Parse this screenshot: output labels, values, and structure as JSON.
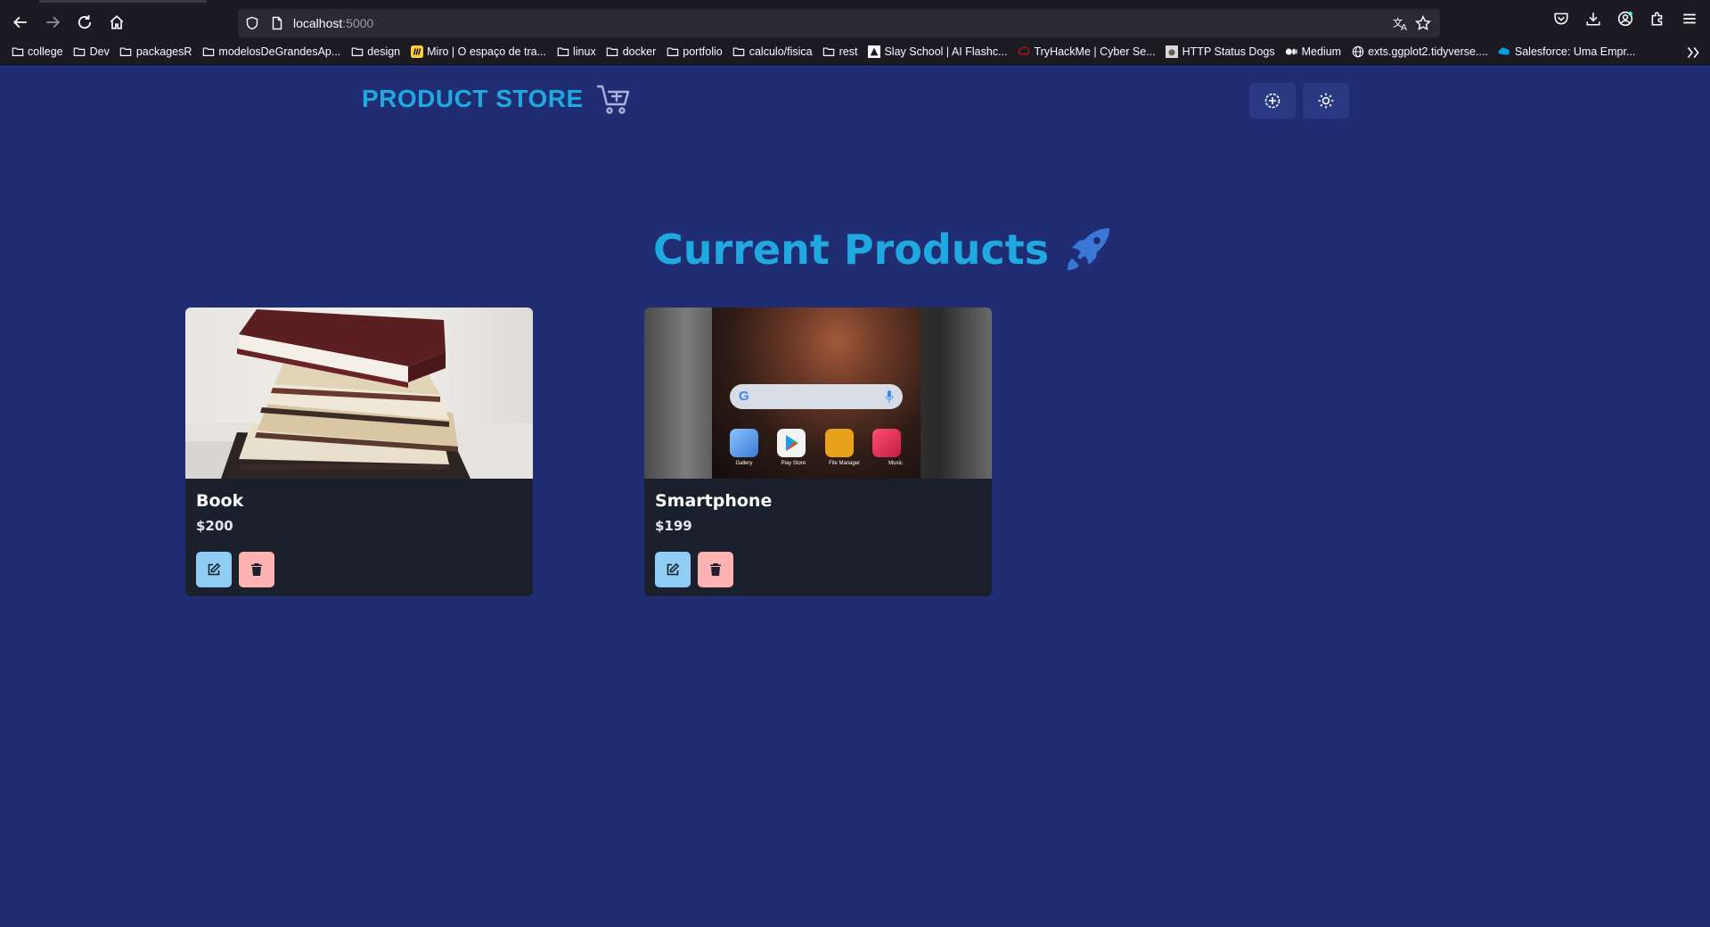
{
  "browser": {
    "url_host": "localhost",
    "url_port": ":5000",
    "bookmarks": [
      {
        "label": "college",
        "icon": "folder-icon"
      },
      {
        "label": "Dev",
        "icon": "folder-icon"
      },
      {
        "label": "packagesR",
        "icon": "folder-icon"
      },
      {
        "label": "modelosDeGrandesAp...",
        "icon": "folder-icon"
      },
      {
        "label": "design",
        "icon": "folder-icon"
      },
      {
        "label": "Miro | O espaço de tra...",
        "icon": "miro-icon"
      },
      {
        "label": "linux",
        "icon": "folder-icon"
      },
      {
        "label": "docker",
        "icon": "folder-icon"
      },
      {
        "label": "portfolio",
        "icon": "folder-icon"
      },
      {
        "label": "calculo/fisica",
        "icon": "folder-icon"
      },
      {
        "label": "rest",
        "icon": "folder-icon"
      },
      {
        "label": "Slay School | AI Flashc...",
        "icon": "slay-icon"
      },
      {
        "label": "TryHackMe | Cyber Se...",
        "icon": "tryhackme-icon"
      },
      {
        "label": "HTTP Status Dogs",
        "icon": "dog-icon"
      },
      {
        "label": "Medium",
        "icon": "medium-icon"
      },
      {
        "label": "exts.ggplot2.tidyverse....",
        "icon": "globe-icon"
      },
      {
        "label": "Salesforce: Uma Empr...",
        "icon": "salesforce-icon"
      }
    ]
  },
  "app": {
    "brand": "PRODUCT STORE",
    "heading": "Current Products",
    "colors": {
      "accent": "#1fa9e0",
      "background": "#212d72",
      "card": "#1a202c",
      "edit": "#90cdf4",
      "delete": "#feb2b2"
    }
  },
  "products": [
    {
      "name": "Book",
      "price": "$200"
    },
    {
      "name": "Smartphone",
      "price": "$199"
    }
  ],
  "phone_screen": {
    "apps": [
      "Gallery",
      "Play Store",
      "File Manager",
      "Music"
    ]
  }
}
